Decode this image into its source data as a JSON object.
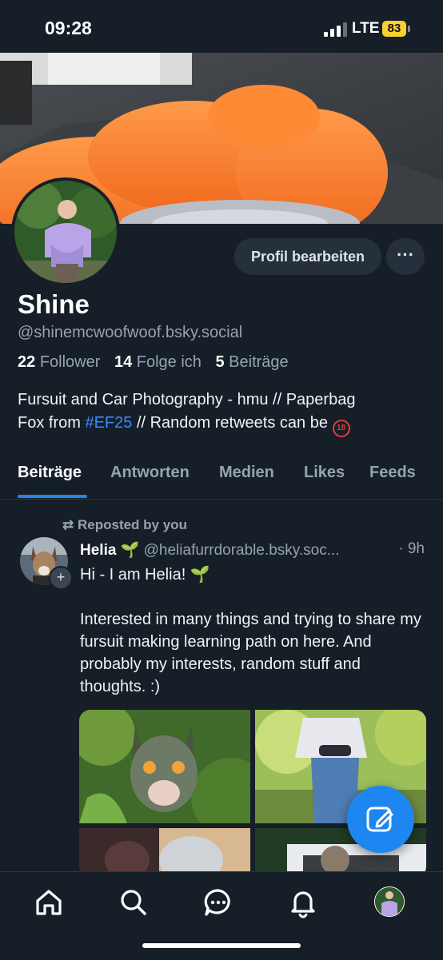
{
  "status_bar": {
    "time": "09:28",
    "network": "LTE",
    "battery": "83"
  },
  "profile": {
    "display_name": "Shine",
    "handle": "@shinemcwoofwoof.bsky.social",
    "followers_count": "22",
    "followers_label": "Follower",
    "following_count": "14",
    "following_label": "Folge ich",
    "posts_count": "5",
    "posts_label": "Beiträge",
    "bio_line1": "Fursuit and Car Photography - hmu // Paperbag",
    "bio_prefix": "Fox from ",
    "bio_hashtag": "#EF25",
    "bio_suffix": " // Random retweets can be ",
    "bio_emoji": "18",
    "edit_button": "Profil bearbeiten",
    "more_button": "···"
  },
  "tabs": [
    {
      "label": "Beiträge",
      "active": true
    },
    {
      "label": "Antworten",
      "active": false
    },
    {
      "label": "Medien",
      "active": false
    },
    {
      "label": "Likes",
      "active": false
    },
    {
      "label": "Feeds",
      "active": false
    }
  ],
  "post": {
    "repost_label": "Reposted by you",
    "author": "Helia 🌱",
    "handle": "@heliafurrdorable.bsky.soc...",
    "time": "· 9h",
    "line1": "Hi - I am Helia! 🌱",
    "line2": "Interested in many things and trying to share my fursuit making learning path on here. And probably my interests, random stuff and thoughts. :)"
  },
  "nav": {
    "icons": [
      "home-icon",
      "search-icon",
      "chat-icon",
      "bell-icon",
      "profile-avatar"
    ]
  },
  "colors": {
    "background": "#161e27",
    "accent": "#1e86f0",
    "muted_text": "#95a3b2",
    "hashtag": "#3b8bff"
  }
}
